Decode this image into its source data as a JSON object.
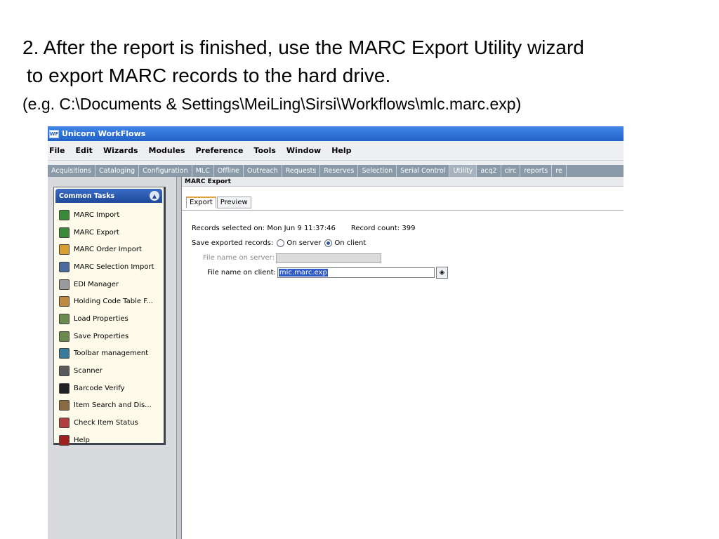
{
  "slide": {
    "line1": "2. After the report is finished, use the MARC Export Utility wizard",
    "line2": "to export MARC records to the hard drive.",
    "line3": "(e.g. C:\\Documents & Settings\\MeiLing\\Sirsi\\Workflows\\mlc.marc.exp)"
  },
  "window": {
    "title": "Unicorn WorkFlows",
    "icon_text": "WF"
  },
  "menu": [
    "File",
    "Edit",
    "Wizards",
    "Modules",
    "Preference",
    "Tools",
    "Window",
    "Help"
  ],
  "modules": [
    "Acquisitions",
    "Cataloging",
    "Configuration",
    "MLC",
    "Offline",
    "Outreach",
    "Requests",
    "Reserves",
    "Selection",
    "Serial Control",
    "Utility",
    "acq2",
    "circ",
    "reports",
    "re"
  ],
  "active_module": "Utility",
  "sidebar": {
    "title": "Common Tasks",
    "collapse_glyph": "»",
    "items": [
      {
        "label": "MARC Import",
        "icon": "marc-import-icon",
        "color": "#3a8a3a"
      },
      {
        "label": "MARC Export",
        "icon": "marc-export-icon",
        "color": "#3a8a3a"
      },
      {
        "label": "MARC Order Import",
        "icon": "marc-order-import-icon",
        "color": "#d9a030"
      },
      {
        "label": "MARC Selection Import",
        "icon": "marc-selection-import-icon",
        "color": "#4a6aa0"
      },
      {
        "label": "EDI Manager",
        "icon": "edi-manager-icon",
        "color": "#9a9a9a"
      },
      {
        "label": "Holding Code Table F...",
        "icon": "holding-code-table-icon",
        "color": "#c08a40"
      },
      {
        "label": "Load Properties",
        "icon": "load-properties-icon",
        "color": "#6a8a50"
      },
      {
        "label": "Save Properties",
        "icon": "save-properties-icon",
        "color": "#6a8a50"
      },
      {
        "label": "Toolbar management",
        "icon": "toolbar-management-icon",
        "color": "#3a7a9a"
      },
      {
        "label": "Scanner",
        "icon": "scanner-icon",
        "color": "#5a5a5a"
      },
      {
        "label": "Barcode Verify",
        "icon": "barcode-verify-icon",
        "color": "#222222"
      },
      {
        "label": "Item Search and Dis...",
        "icon": "item-search-icon",
        "color": "#8a6a40"
      },
      {
        "label": "Check Item Status",
        "icon": "check-item-status-icon",
        "color": "#b04040"
      },
      {
        "label": "Help",
        "icon": "help-icon",
        "color": "#a02020"
      }
    ]
  },
  "export": {
    "section_title": "MARC Export",
    "tabs": [
      "Export",
      "Preview"
    ],
    "records_selected_label": "Records selected on: Mon Jun  9 11:37:46",
    "record_count_label": "Record count: 399",
    "save_label": "Save exported records:",
    "option_server": "On server",
    "option_client": "On client",
    "selected_option": "On client",
    "server_filename_label": "File name on server:",
    "server_filename_value": "",
    "client_filename_label": "File name on client:",
    "client_filename_value": "mlc.marc.exp",
    "browse_glyph": "◈"
  }
}
